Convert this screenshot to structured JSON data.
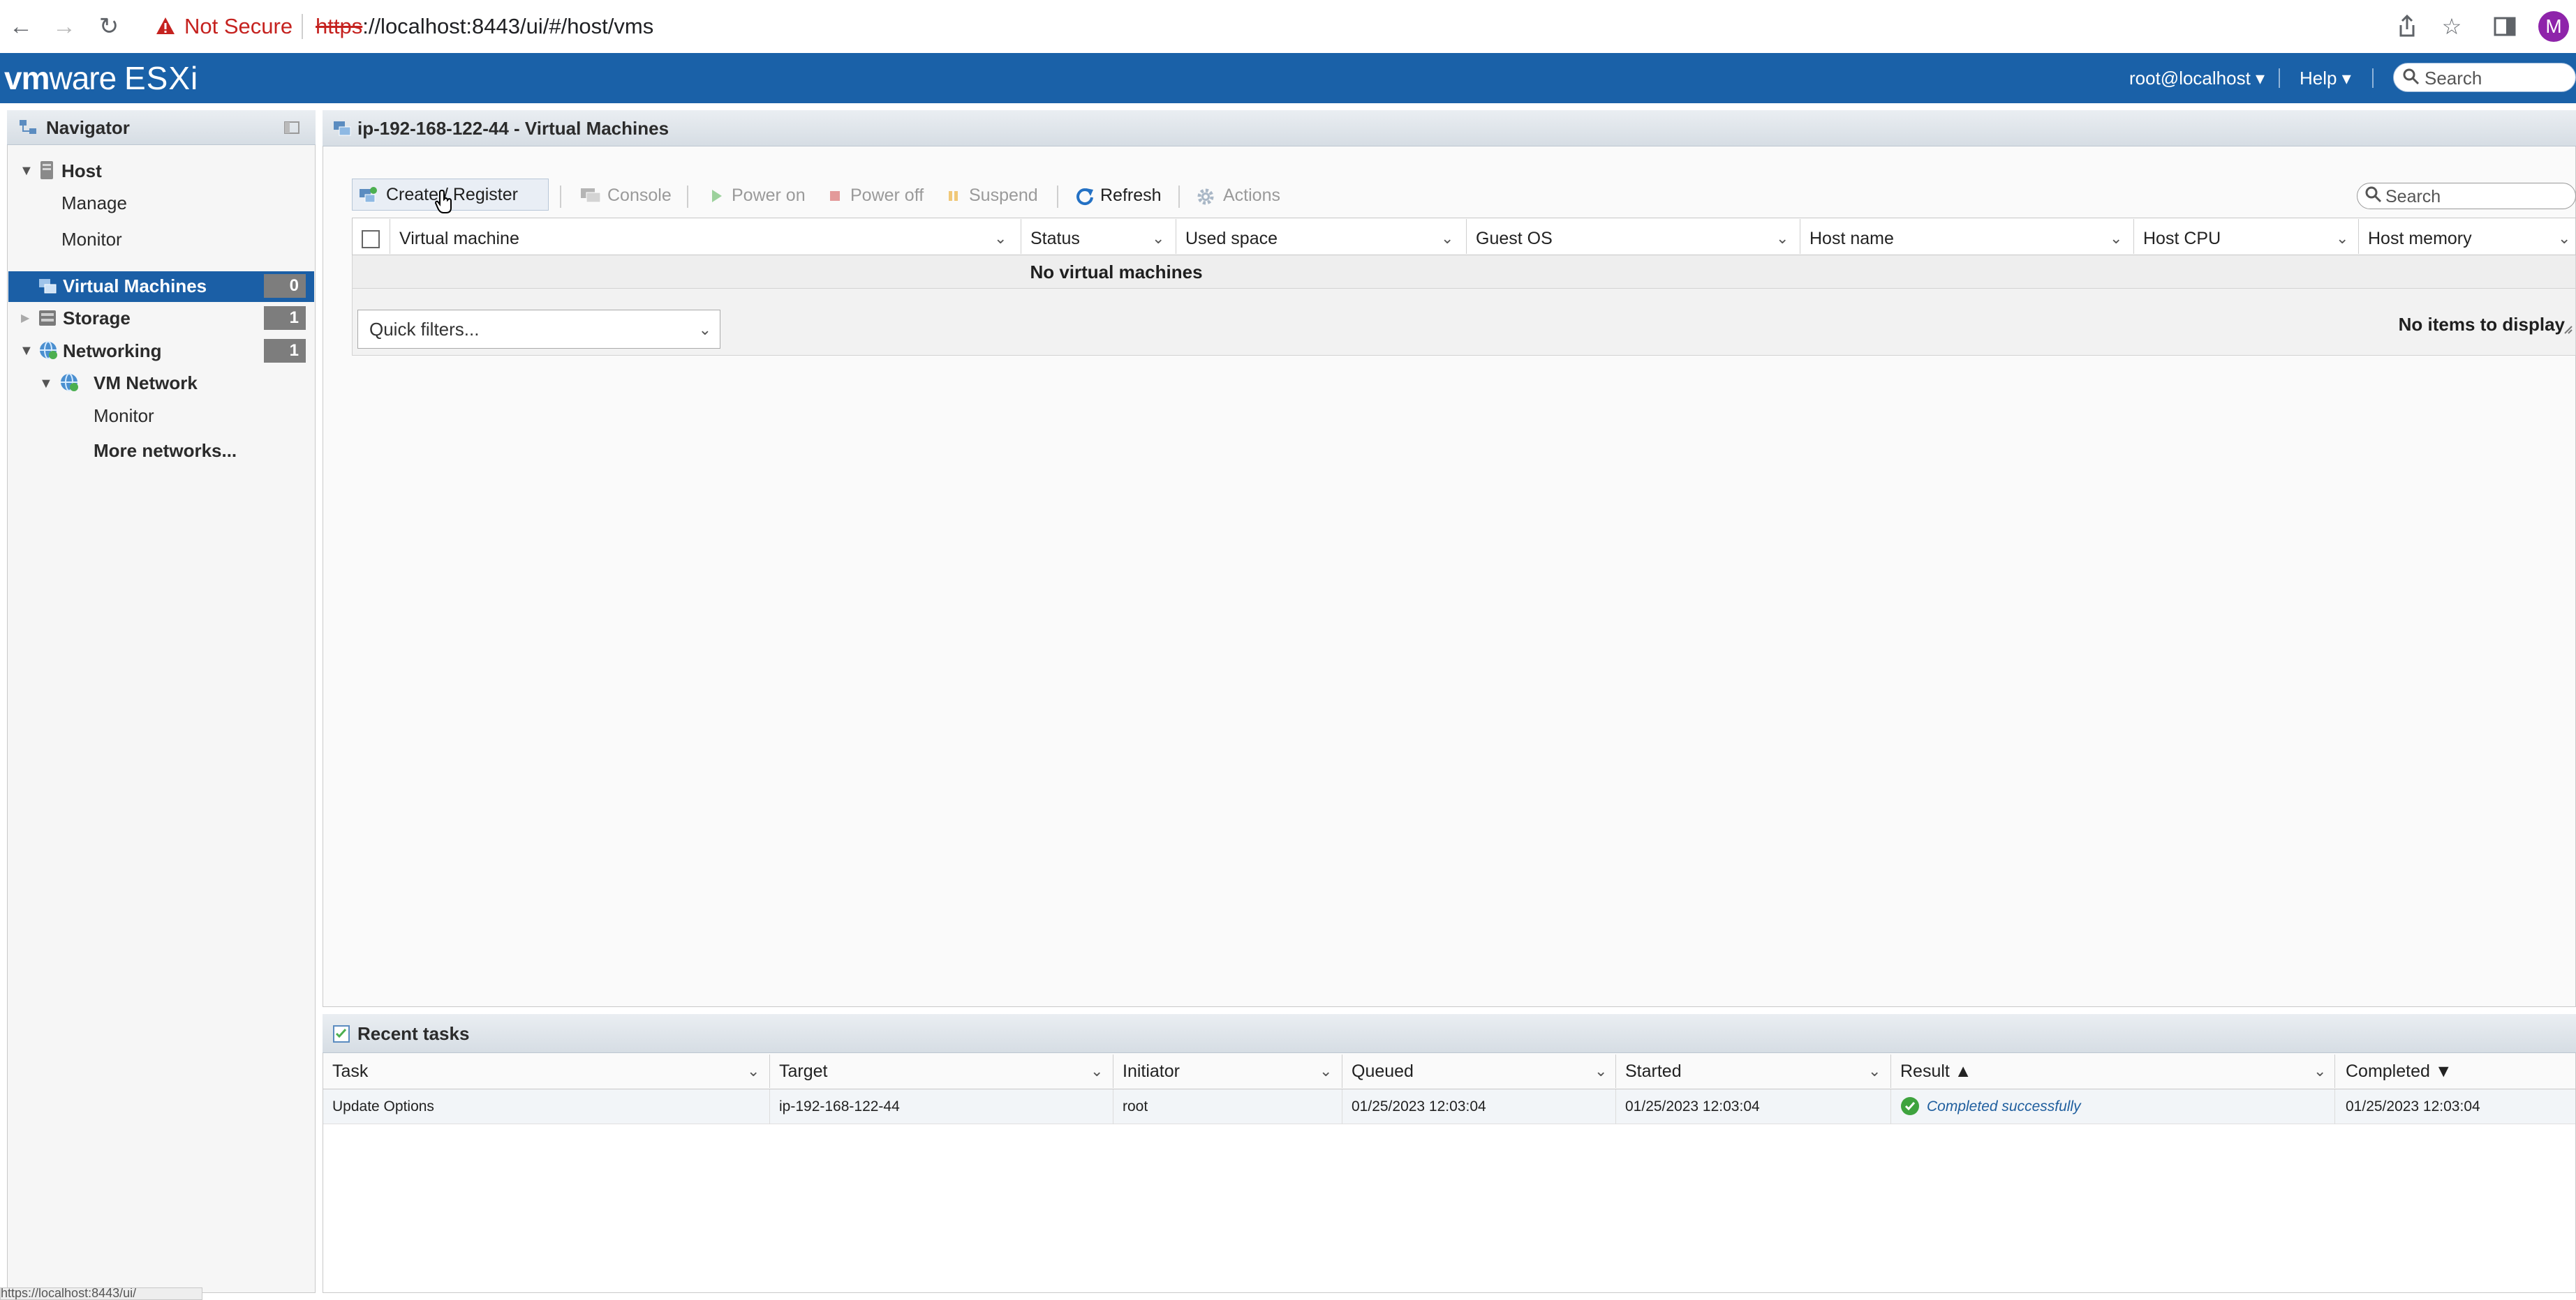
{
  "browser": {
    "not_secure_label": "Not Secure",
    "url_protocol": "https",
    "url_rest": "://localhost:8443/ui/#/host/vms",
    "profile_initial": "M"
  },
  "header": {
    "brand_vm": "vm",
    "brand_ware": "ware",
    "brand_product": "ESXi",
    "user_menu": "root@localhost ▾",
    "help_menu": "Help ▾",
    "search_placeholder": "Search"
  },
  "navigator": {
    "title": "Navigator",
    "items": [
      {
        "label": "Host"
      },
      {
        "label": "Manage"
      },
      {
        "label": "Monitor"
      },
      {
        "label": "Virtual Machines",
        "count": "0"
      },
      {
        "label": "Storage",
        "count": "1"
      },
      {
        "label": "Networking",
        "count": "1"
      },
      {
        "label": "VM Network"
      },
      {
        "label": "Monitor"
      },
      {
        "label": "More networks..."
      }
    ]
  },
  "main": {
    "title": "ip-192-168-122-44 - Virtual Machines",
    "toolbar": {
      "create": "Create / Register VM",
      "console": "Console",
      "power_on": "Power on",
      "power_off": "Power off",
      "suspend": "Suspend",
      "refresh": "Refresh",
      "actions": "Actions",
      "search_placeholder": "Search"
    },
    "columns": [
      "Virtual machine",
      "Status",
      "Used space",
      "Guest OS",
      "Host name",
      "Host CPU",
      "Host memory"
    ],
    "empty_message": "No virtual machines",
    "quick_filters": "Quick filters...",
    "items_status": "No items to display"
  },
  "tasks": {
    "title": "Recent tasks",
    "columns": [
      "Task",
      "Target",
      "Initiator",
      "Queued",
      "Started",
      "Result ▲",
      "Completed ▼"
    ],
    "rows": [
      {
        "task": "Update Options",
        "target": "ip-192-168-122-44",
        "initiator": "root",
        "queued": "01/25/2023 12:03:04",
        "started": "01/25/2023 12:03:04",
        "result": "Completed successfully",
        "completed": "01/25/2023 12:03:04"
      }
    ]
  },
  "status_bar": {
    "url": "https://localhost:8443/ui/"
  },
  "colors": {
    "header_blue": "#1a61a8",
    "selected_blue": "#1b5fa6",
    "success_green": "#3ea33e",
    "not_secure_red": "#c5221f"
  }
}
